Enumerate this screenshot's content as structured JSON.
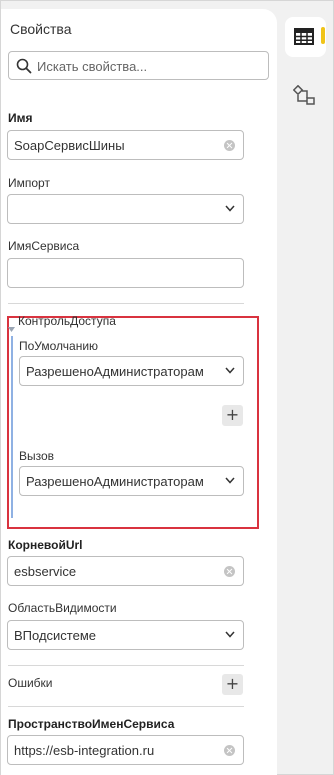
{
  "panel": {
    "title": "Свойства",
    "search_placeholder": "Искать свойства..."
  },
  "fields": {
    "name": {
      "label": "Имя",
      "value": "SoapСервисШины"
    },
    "import": {
      "label": "Импорт",
      "value": ""
    },
    "service_name": {
      "label": "ИмяСервиса",
      "value": ""
    },
    "access": {
      "label": "КонтрольДоступа",
      "default": {
        "label": "ПоУмолчанию",
        "value": "РазрешеноАдминистраторам"
      },
      "call": {
        "label": "Вызов",
        "value": "РазрешеноАдминистраторам"
      }
    },
    "root_url": {
      "label": "КорневойUrl",
      "value": "esbservice"
    },
    "visibility": {
      "label": "ОбластьВидимости",
      "value": "ВПодсистеме"
    },
    "errors": {
      "label": "Ошибки"
    },
    "namespace": {
      "label": "ПространствоИменСервиса",
      "value": "https://esb-integration.ru"
    }
  },
  "icons": {
    "search": "search-icon",
    "clear": "clear-icon",
    "dropdown": "chevron-down-icon",
    "add": "plus-icon",
    "properties_tab": "table-icon",
    "diagram_tab": "diagram-icon"
  },
  "colors": {
    "highlight_border": "#d9333f",
    "group_line": "#8fb1e3",
    "active_tab_accent": "#f0c419"
  }
}
